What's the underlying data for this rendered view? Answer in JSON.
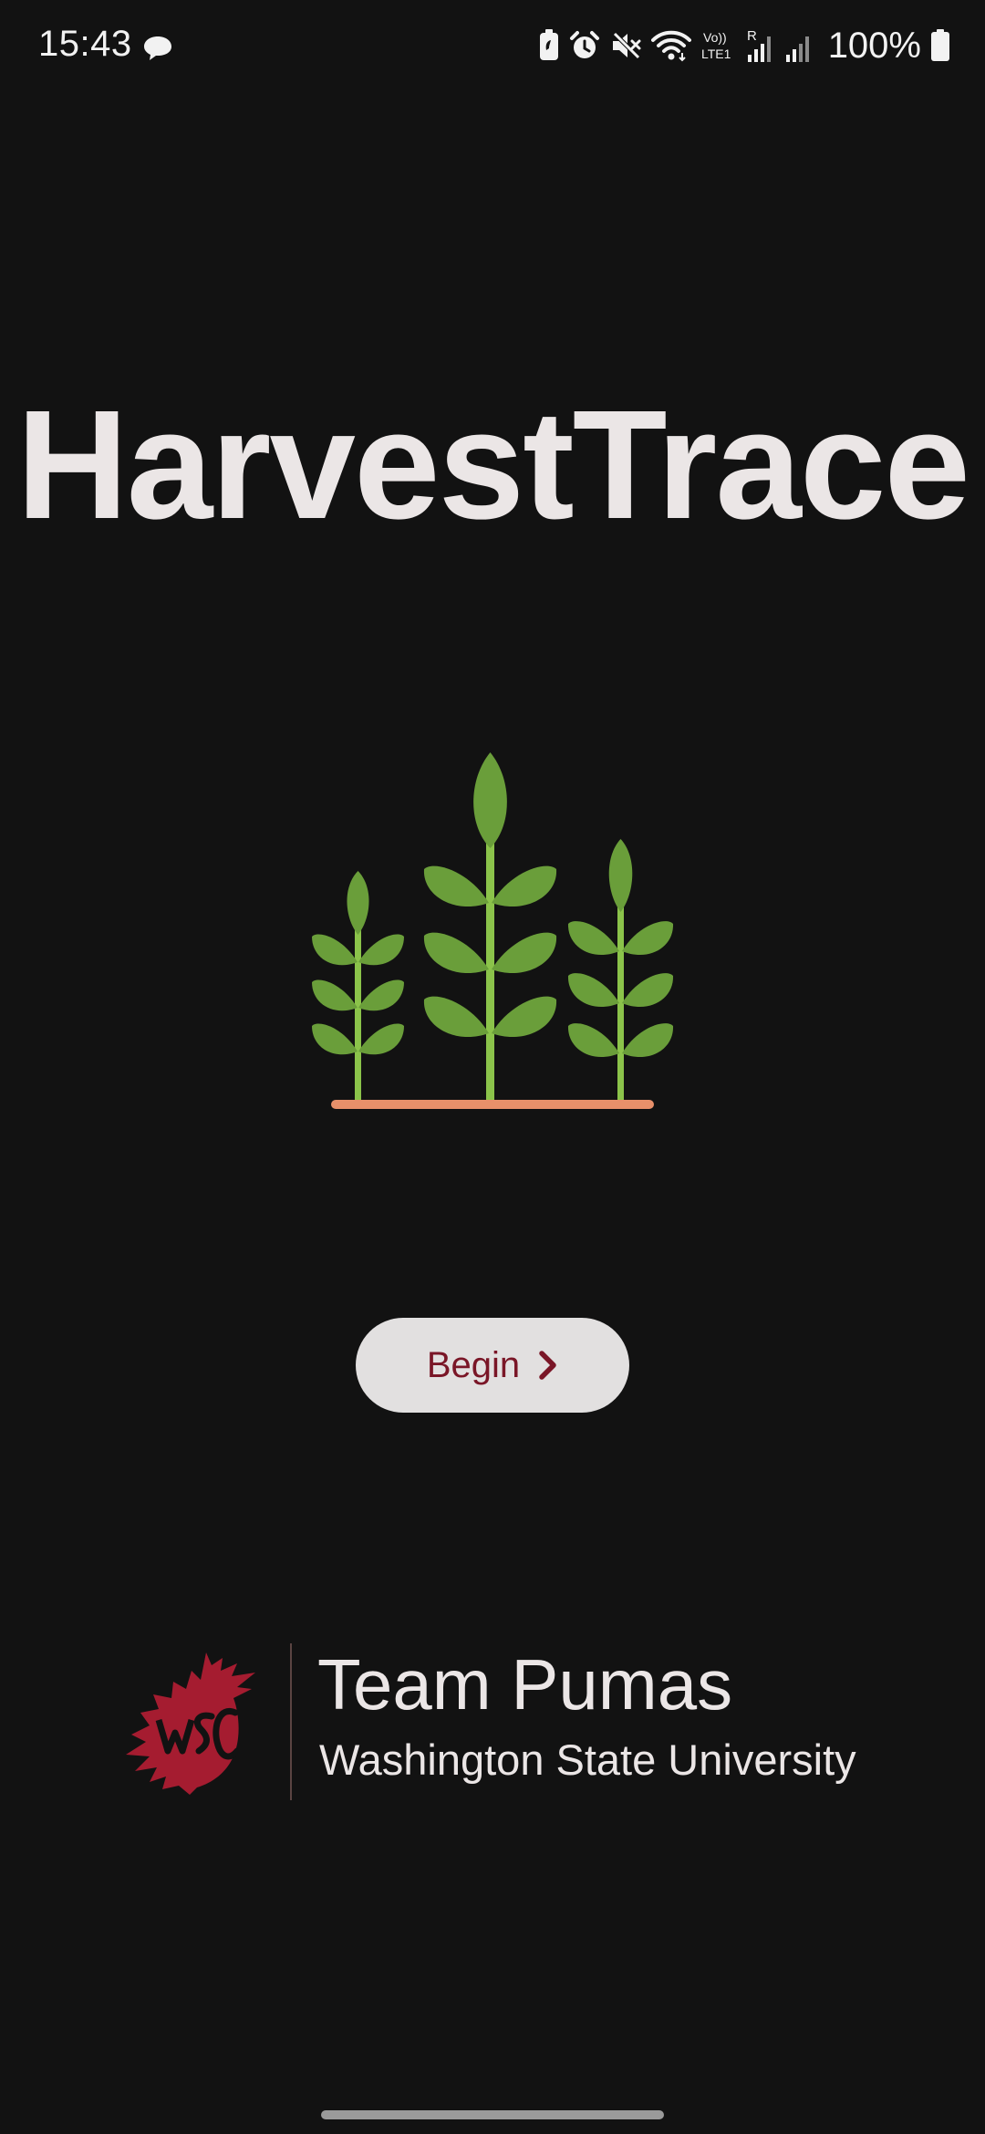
{
  "status_bar": {
    "time": "15:43",
    "battery_text": "100%",
    "icons": [
      "chat-bubble-icon",
      "battery-saver-icon",
      "alarm-icon",
      "mute-icon",
      "wifi-icon",
      "volte-icon",
      "roaming-signal-icon",
      "signal-icon",
      "battery-icon"
    ],
    "volte_label": "Vo)) LTE1",
    "roaming_label": "R"
  },
  "app": {
    "title": "HarvestTrace",
    "illustration_icon": "plants-icon"
  },
  "begin_button": {
    "label": "Begin",
    "icon": "chevron-right-icon"
  },
  "footer": {
    "logo_icon": "wsu-cougar-logo-icon",
    "team_name": "Team Pumas",
    "university": "Washington State University"
  },
  "colors": {
    "background": "#121212",
    "title_text": "#ebe6e6",
    "leaf_green": "#6a9e3a",
    "stem_green": "#8bc34a",
    "soil": "#e8906a",
    "button_bg": "#e2e0e0",
    "button_text": "#7a1627",
    "logo_crimson": "#a51c30"
  }
}
